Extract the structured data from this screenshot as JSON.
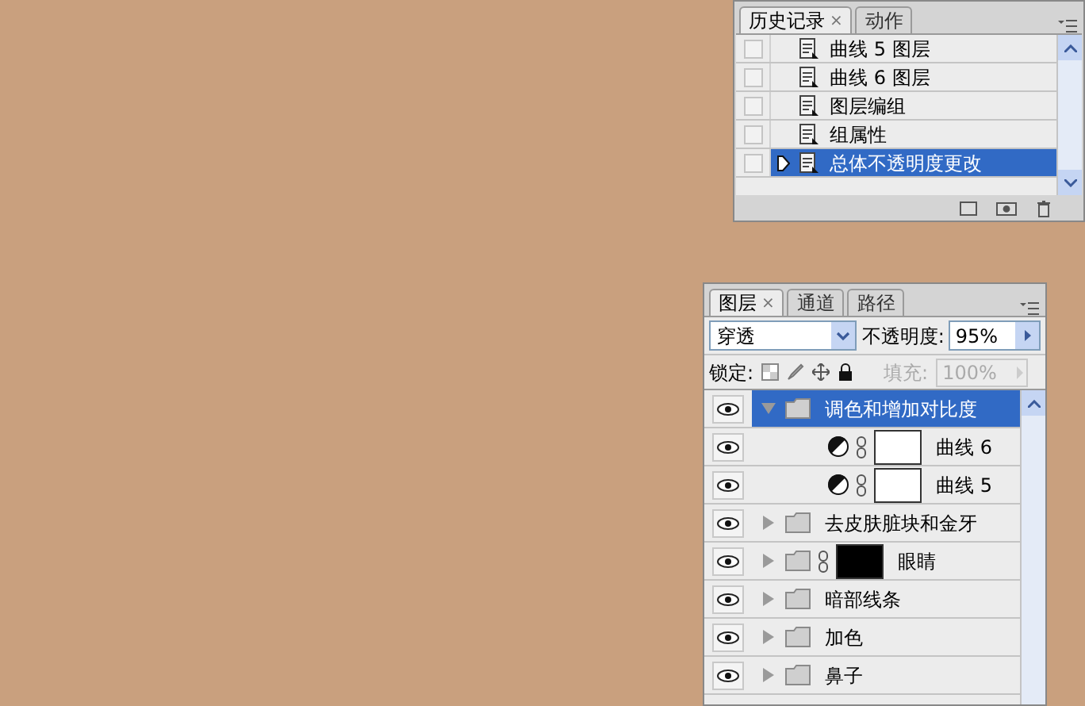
{
  "history": {
    "tabs": [
      {
        "label": "历史记录",
        "selected": true,
        "close": "×"
      },
      {
        "label": "动作",
        "selected": false
      }
    ],
    "items": [
      {
        "label": "曲线 5 图层",
        "selected": false,
        "checked": false
      },
      {
        "label": "曲线 6 图层",
        "selected": false,
        "checked": false
      },
      {
        "label": "图层编组",
        "selected": false,
        "checked": false
      },
      {
        "label": "组属性",
        "selected": false,
        "checked": false
      },
      {
        "label": "总体不透明度更改",
        "selected": true,
        "checked": false
      }
    ]
  },
  "layers": {
    "tabs": [
      {
        "label": "图层",
        "selected": true,
        "close": "×"
      },
      {
        "label": "通道",
        "selected": false
      },
      {
        "label": "路径",
        "selected": false
      }
    ],
    "blend_mode": "穿透",
    "opacity_label": "不透明度:",
    "opacity": "95%",
    "lock_label": "锁定:",
    "fill_label": "填充:",
    "fill": "100%",
    "items": [
      {
        "kind": "group",
        "name": "调色和增加对比度",
        "visible": true,
        "selected": true,
        "expanded": true,
        "children": [
          {
            "kind": "adjustment",
            "name": "曲线 6",
            "visible": true,
            "selected": false,
            "color": "#ffffff"
          },
          {
            "kind": "adjustment",
            "name": "曲线 5",
            "visible": true,
            "selected": false,
            "color": "#ffffff"
          }
        ]
      },
      {
        "kind": "group",
        "name": "去皮肤脏块和金牙",
        "visible": true,
        "selected": false,
        "expanded": false
      },
      {
        "kind": "group",
        "name": "眼睛",
        "visible": true,
        "selected": false,
        "expanded": false,
        "color": "#000000"
      },
      {
        "kind": "group",
        "name": "暗部线条",
        "visible": true,
        "selected": false,
        "expanded": false
      },
      {
        "kind": "group",
        "name": "加色",
        "visible": true,
        "selected": false,
        "expanded": false
      },
      {
        "kind": "group",
        "name": "鼻子",
        "visible": true,
        "selected": false,
        "expanded": false
      }
    ]
  }
}
